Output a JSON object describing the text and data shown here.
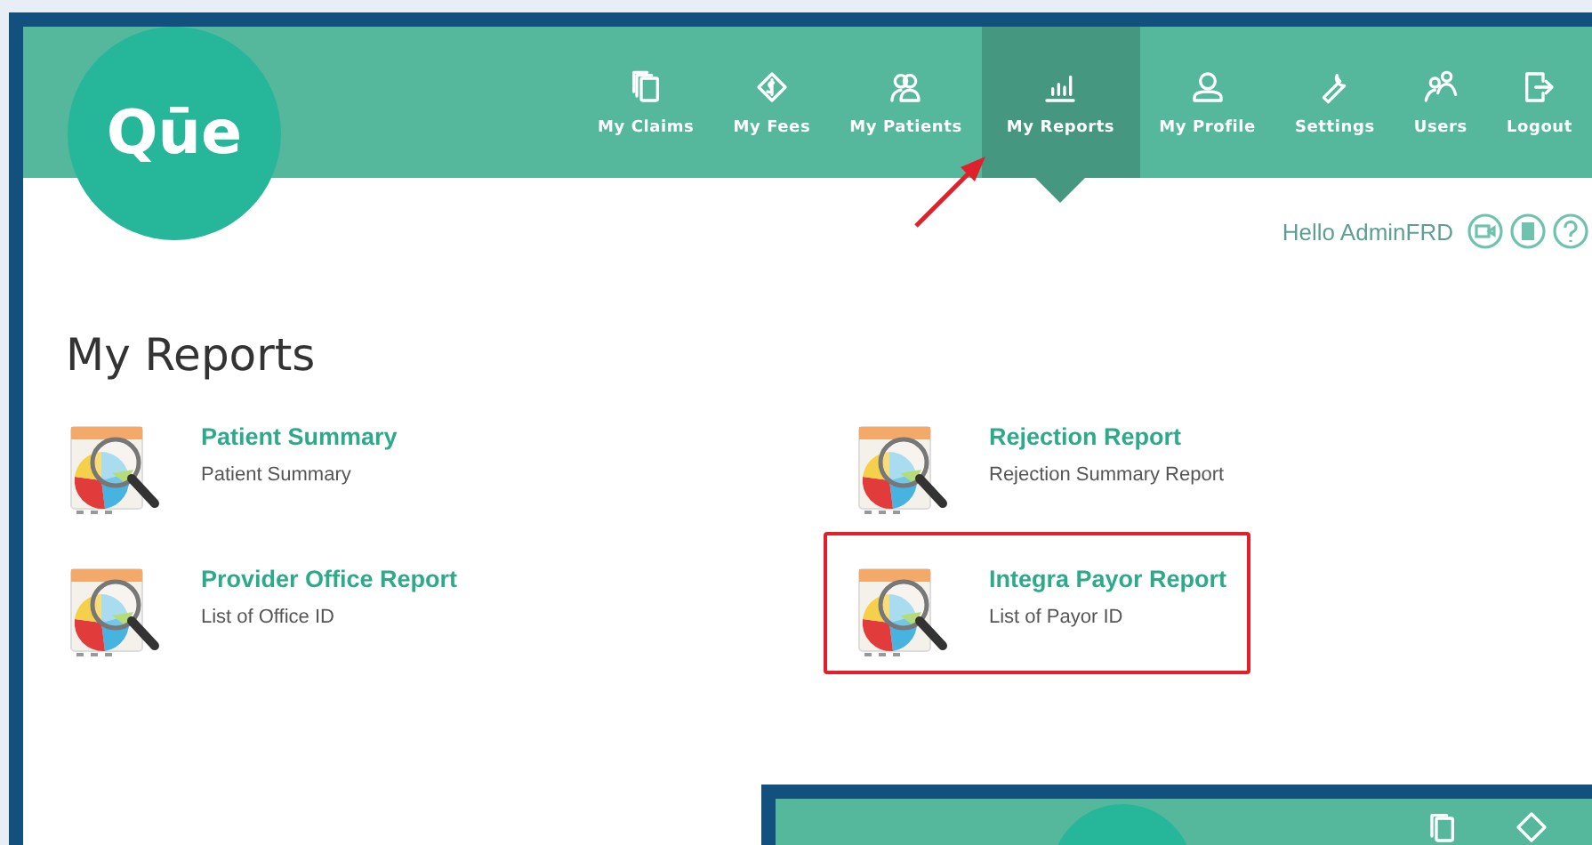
{
  "logo": {
    "text": "Qūe"
  },
  "nav": [
    {
      "label": "My Claims",
      "selected": false
    },
    {
      "label": "My Fees",
      "selected": false
    },
    {
      "label": "My Patients",
      "selected": false
    },
    {
      "label": "My Reports",
      "selected": true
    },
    {
      "label": "My Profile",
      "selected": false
    },
    {
      "label": "Settings",
      "selected": false
    },
    {
      "label": "Users",
      "selected": false
    },
    {
      "label": "Logout",
      "selected": false
    }
  ],
  "greeting": "Hello AdminFRD",
  "page_title": "My Reports",
  "reports": [
    {
      "title": "Patient Summary",
      "description": "Patient Summary",
      "highlighted": false
    },
    {
      "title": "Rejection Report",
      "description": "Rejection Summary Report",
      "highlighted": false
    },
    {
      "title": "Provider Office Report",
      "description": "List of Office ID",
      "highlighted": false
    },
    {
      "title": "Integra Payor Report",
      "description": "List of Payor ID",
      "highlighted": true
    }
  ],
  "annotation_arrow": {
    "shown": true
  },
  "second_screenshot": {
    "shown": true
  }
}
